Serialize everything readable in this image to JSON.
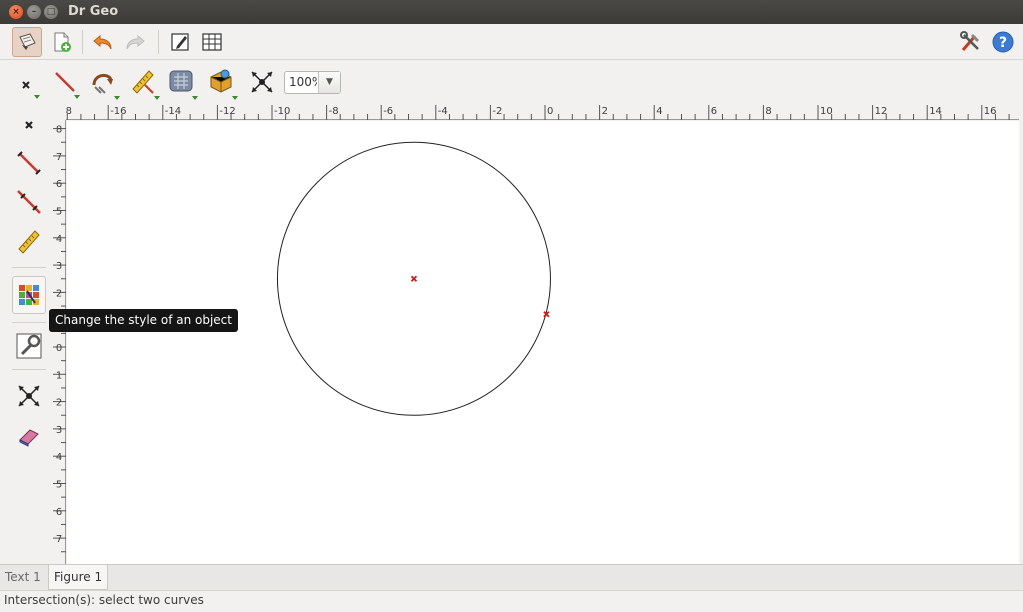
{
  "window": {
    "title": "Dr Geo",
    "close_glyph": "×",
    "min_glyph": "–",
    "max_glyph": "□"
  },
  "toolbar": {
    "icons": [
      "select-arrow-icon",
      "new-figure-icon",
      "undo-icon",
      "redo-icon",
      "edit-icon",
      "grid-icon",
      "preferences-tools-icon",
      "help-icon"
    ],
    "help_glyph": "?"
  },
  "construction_toolbar": {
    "tools": [
      "points-tool-icon",
      "lines-tool-icon",
      "transformations-tool-icon",
      "numerics-tool-icon",
      "scripts-tool-icon",
      "macros-tool-icon",
      "intersection-tool-icon"
    ],
    "zoom_value": "100%"
  },
  "side_toolbar": {
    "tools": [
      "free-point-icon",
      "segment-icon",
      "line-icon",
      "measure-icon",
      "style-icon",
      "properties-wrench-icon",
      "intersection-icon",
      "eraser-icon"
    ]
  },
  "tooltip": {
    "text": "Change the style of an object"
  },
  "rulers": {
    "x_labels": [
      "-18",
      "-16",
      "-14",
      "-12",
      "-10",
      "-8",
      "-6",
      "-4",
      "-2",
      "0",
      "2",
      "4",
      "6",
      "8",
      "10",
      "12",
      "14",
      "16"
    ],
    "y_labels": [
      "8",
      "7",
      "6",
      "5",
      "4",
      "3",
      "2",
      "1",
      "0",
      "-1",
      "-2",
      "-3",
      "-4",
      "-5",
      "-6",
      "-7"
    ]
  },
  "figure": {
    "circle": {
      "center": [
        -4.8,
        2.5
      ],
      "radius": 5
    },
    "points": [
      {
        "name": "center-point",
        "x": -4.8,
        "y": 2.5,
        "color": "#d01818"
      },
      {
        "name": "circle-point",
        "x": 0.05,
        "y": 1.2,
        "color": "#d01818"
      }
    ]
  },
  "tabs": [
    {
      "label": "Text 1",
      "active": false
    },
    {
      "label": "Figure 1",
      "active": true
    }
  ],
  "status": {
    "message": "Intersection(s): select two curves"
  },
  "colors": {
    "titlebar": "#3c3b37",
    "accent": "#dd4814",
    "tooltip_bg": "#151515",
    "point": "#d01818"
  }
}
